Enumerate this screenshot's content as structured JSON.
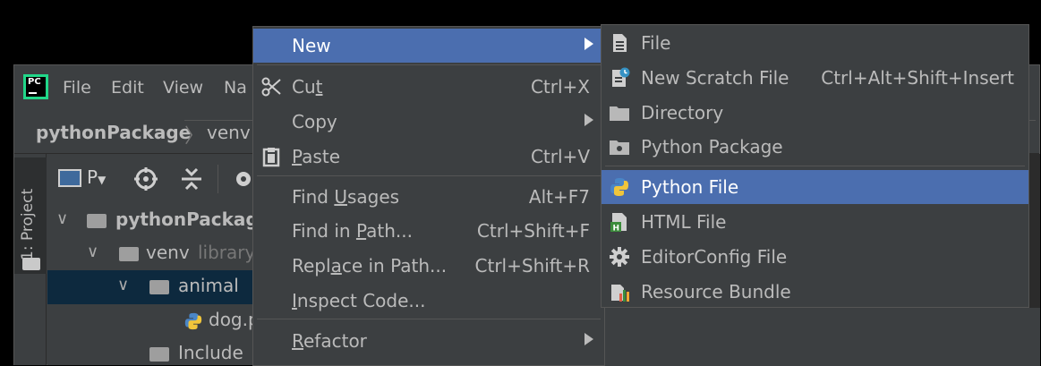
{
  "ide": {
    "menubar": [
      "File",
      "Edit",
      "View",
      "Na"
    ],
    "breadcrumb": {
      "root": "pythonPackage",
      "child": "venv"
    },
    "side_tab": "1: Project",
    "toolbar": {
      "view_selector": "P"
    },
    "tree": [
      {
        "label": "pythonPackage",
        "kind": "folder",
        "bold": true
      },
      {
        "label": "venv",
        "kind": "folder",
        "suffix": "library"
      },
      {
        "label": "animal",
        "kind": "folder",
        "selected": true
      },
      {
        "label": "dog.p",
        "kind": "python"
      },
      {
        "label": "Include",
        "kind": "folder"
      }
    ]
  },
  "context_menu": {
    "items": [
      {
        "label": "New",
        "submenu": true,
        "highlighted": true
      },
      {
        "label": "Cut",
        "mnemonic": "t",
        "shortcut": "Ctrl+X",
        "icon": "scissors-icon"
      },
      {
        "label": "Copy",
        "submenu": true
      },
      {
        "label": "Paste",
        "mnemonic": "P",
        "shortcut": "Ctrl+V",
        "icon": "clipboard-icon"
      },
      {
        "label": "Find Usages",
        "mnemonic": "U",
        "shortcut": "Alt+F7"
      },
      {
        "label": "Find in Path...",
        "mnemonic": "P",
        "shortcut": "Ctrl+Shift+F"
      },
      {
        "label": "Replace in Path...",
        "mnemonic": "a",
        "shortcut": "Ctrl+Shift+R"
      },
      {
        "label": "Inspect Code...",
        "mnemonic": "I"
      },
      {
        "label": "Refactor",
        "mnemonic": "R",
        "submenu": true
      }
    ]
  },
  "new_submenu": {
    "items": [
      {
        "label": "File",
        "icon": "file-icon"
      },
      {
        "label": "New Scratch File",
        "shortcut": "Ctrl+Alt+Shift+Insert",
        "icon": "scratch-file-icon"
      },
      {
        "label": "Directory",
        "icon": "folder-icon"
      },
      {
        "label": "Python Package",
        "icon": "package-folder-icon"
      },
      {
        "label": "Python File",
        "icon": "python-icon",
        "highlighted": true
      },
      {
        "label": "HTML File",
        "icon": "html-file-icon"
      },
      {
        "label": "EditorConfig File",
        "icon": "gear-icon"
      },
      {
        "label": "Resource Bundle",
        "icon": "resource-bundle-icon"
      }
    ]
  },
  "colors": {
    "highlight": "#4b6eaf",
    "menu_bg": "#3c3f41",
    "text": "#bbbbbb",
    "selected_row": "#0d293e"
  }
}
